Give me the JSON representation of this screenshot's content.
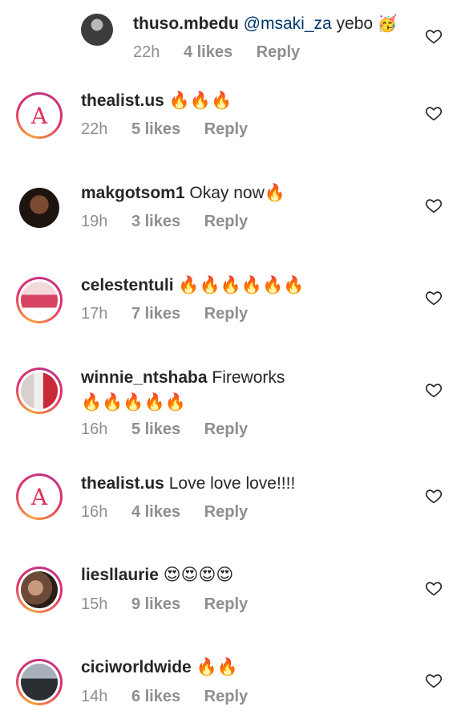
{
  "comments": [
    {
      "username": "thuso.mbedu",
      "mention": "@msaki_za",
      "text": " yebo ",
      "emoji": "🥳",
      "time": "22h",
      "likes": "4 likes",
      "reply": "Reply",
      "avatar": "dark-photo"
    },
    {
      "username": "thealist.us",
      "text": " 🔥🔥🔥",
      "time": "22h",
      "likes": "5 likes",
      "reply": "Reply",
      "avatar": "letter-a"
    },
    {
      "username": "makgotsom1",
      "text": " Okay now🔥",
      "time": "19h",
      "likes": "3 likes",
      "reply": "Reply",
      "avatar": "portrait"
    },
    {
      "username": "celestentuli",
      "text": " 🔥🔥🔥🔥🔥🔥",
      "time": "17h",
      "likes": "7 likes",
      "reply": "Reply",
      "avatar": "poster"
    },
    {
      "username": "winnie_ntshaba",
      "text": " Fireworks",
      "text2": "🔥🔥🔥🔥🔥",
      "time": "16h",
      "likes": "5 likes",
      "reply": "Reply",
      "avatar": "photo"
    },
    {
      "username": "thealist.us",
      "text": " Love love love!!!!",
      "time": "16h",
      "likes": "4 likes",
      "reply": "Reply",
      "avatar": "letter-a"
    },
    {
      "username": "liesllaurie",
      "text": " 😍😍😍😍",
      "time": "15h",
      "likes": "9 likes",
      "reply": "Reply",
      "avatar": "photo"
    },
    {
      "username": "ciciworldwide",
      "text": " 🔥🔥",
      "time": "14h",
      "likes": "6 likes",
      "reply": "Reply",
      "avatar": "photo"
    }
  ],
  "avatar_letter": "A",
  "colors": {
    "text": "#262626",
    "meta": "#8e8e8e",
    "mention": "#00376b",
    "story_ring_start": "#f9a13a",
    "story_ring_end": "#c13584"
  },
  "icons": {
    "like": "heart-outline-icon"
  }
}
